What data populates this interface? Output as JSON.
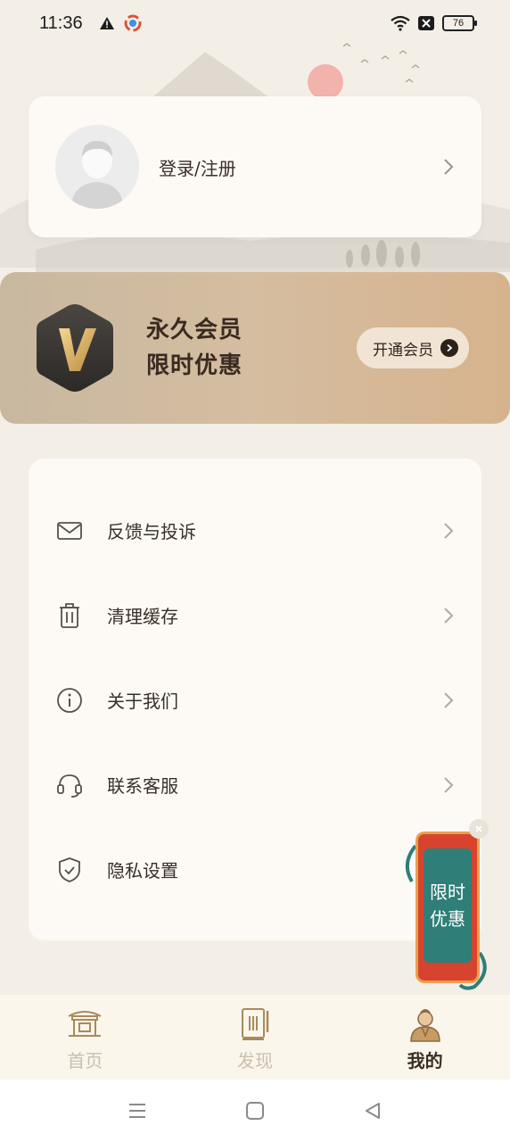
{
  "status_bar": {
    "time": "11:36",
    "battery": "76",
    "icons": [
      "warning-icon",
      "app-notification-icon",
      "wifi-icon",
      "no-sim-icon",
      "battery-icon"
    ]
  },
  "profile": {
    "login_label": "登录/注册"
  },
  "vip": {
    "line1": "永久会员",
    "line2": "限时优惠",
    "badge_letter": "V",
    "button_label": "开通会员"
  },
  "menu": {
    "items": [
      {
        "label": "反馈与投诉",
        "icon": "mail-icon"
      },
      {
        "label": "清理缓存",
        "icon": "trash-icon"
      },
      {
        "label": "关于我们",
        "icon": "info-icon"
      },
      {
        "label": "联系客服",
        "icon": "headset-icon"
      },
      {
        "label": "隐私设置",
        "icon": "shield-icon"
      }
    ]
  },
  "promo": {
    "line1": "限时",
    "line2": "优惠"
  },
  "bottom_nav": {
    "items": [
      {
        "label": "首页",
        "icon": "temple-icon",
        "active": false
      },
      {
        "label": "发现",
        "icon": "scroll-icon",
        "active": false
      },
      {
        "label": "我的",
        "icon": "scholar-icon",
        "active": true
      }
    ]
  },
  "colors": {
    "background": "#f4efe6",
    "card": "#fdfaf5",
    "vip_gradient_start": "#c8b8a0",
    "vip_gradient_end": "#d6b38d",
    "nav_inactive": "#c9bfae",
    "nav_active": "#3a2e22"
  }
}
